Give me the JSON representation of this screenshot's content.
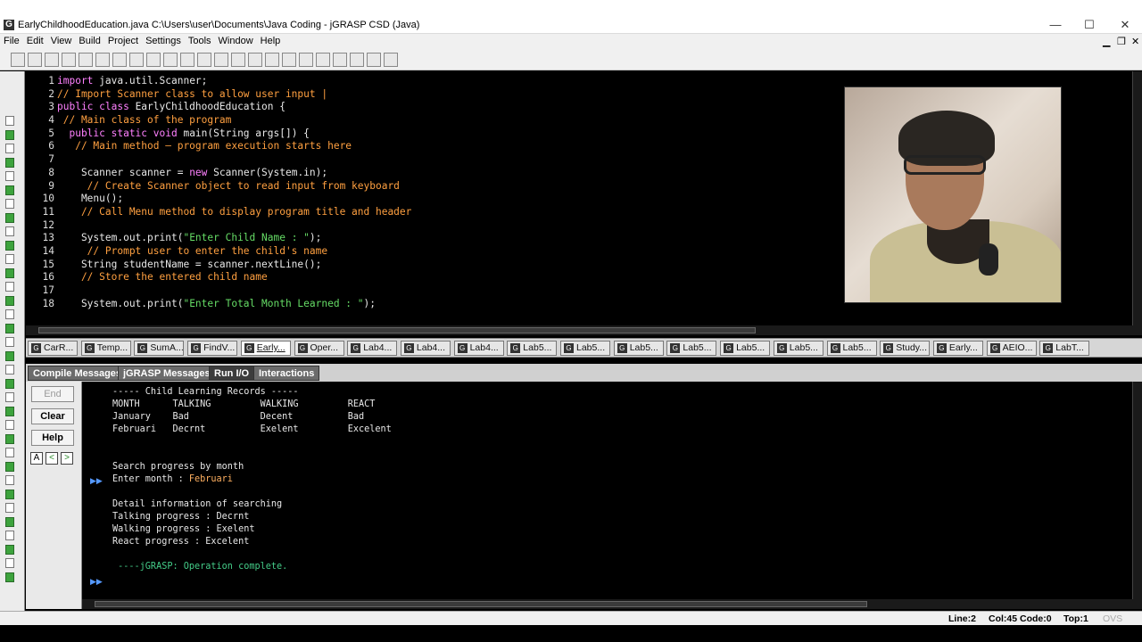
{
  "window": {
    "title": "EarlyChildhoodEducation.java  C:\\Users\\user\\Documents\\Java Coding - jGRASP CSD (Java)",
    "app_icon": "G",
    "controls": {
      "minimize": "—",
      "maximize": "☐",
      "close": "✕"
    }
  },
  "menu": {
    "items": [
      "File",
      "Edit",
      "View",
      "Build",
      "Project",
      "Settings",
      "Tools",
      "Window",
      "Help"
    ],
    "right_controls": [
      "▁",
      "❐",
      "✕"
    ]
  },
  "toolbar": {
    "icons": [
      "open-folder-icon",
      "save-icon",
      "save-all-icon",
      "print-icon",
      "cut-icon",
      "copy-icon",
      "paste-icon",
      "undo-icon",
      "redo-icon",
      "font-icon",
      "new-file-icon",
      "new-doc-icon",
      "new-doc2-icon",
      "breakpoint-icon",
      "chart-icon",
      "run-icon",
      "book-icon",
      "add-icon",
      "debug-icon",
      "bug-icon",
      "stop-icon",
      "window-icon",
      "green-icon"
    ]
  },
  "editor": {
    "lines": [
      {
        "n": "1",
        "segs": [
          {
            "t": "import",
            "c": "kw"
          },
          {
            "t": " java.util.Scanner;",
            "c": ""
          }
        ]
      },
      {
        "n": "2",
        "segs": [
          {
            "t": "// Import Scanner class to allow user input |",
            "c": "cm"
          }
        ]
      },
      {
        "n": "3",
        "segs": [
          {
            "t": "public class",
            "c": "kw"
          },
          {
            "t": " EarlyChildhoodEducation {",
            "c": ""
          }
        ]
      },
      {
        "n": "4",
        "segs": [
          {
            "t": " // Main class of the program",
            "c": "cm"
          }
        ]
      },
      {
        "n": "5",
        "segs": [
          {
            "t": "  public static void",
            "c": "kw"
          },
          {
            "t": " main(String args[]) {",
            "c": ""
          }
        ]
      },
      {
        "n": "6",
        "segs": [
          {
            "t": "   // Main method – program execution starts here",
            "c": "cm"
          }
        ]
      },
      {
        "n": "7",
        "segs": [
          {
            "t": "",
            "c": ""
          }
        ]
      },
      {
        "n": "8",
        "segs": [
          {
            "t": "    Scanner scanner = ",
            "c": ""
          },
          {
            "t": "new",
            "c": "kw"
          },
          {
            "t": " Scanner(System.in);",
            "c": ""
          }
        ]
      },
      {
        "n": "9",
        "segs": [
          {
            "t": "     // Create Scanner object to read input from keyboard",
            "c": "cm"
          }
        ]
      },
      {
        "n": "10",
        "segs": [
          {
            "t": "    Menu();",
            "c": ""
          }
        ]
      },
      {
        "n": "11",
        "segs": [
          {
            "t": "    // Call Menu method to display program title and header",
            "c": "cm"
          }
        ]
      },
      {
        "n": "12",
        "segs": [
          {
            "t": "",
            "c": ""
          }
        ]
      },
      {
        "n": "13",
        "segs": [
          {
            "t": "    System.out.print(",
            "c": ""
          },
          {
            "t": "\"Enter Child Name : \"",
            "c": "st"
          },
          {
            "t": ");",
            "c": ""
          }
        ]
      },
      {
        "n": "14",
        "segs": [
          {
            "t": "     // Prompt user to enter the child's name",
            "c": "cm"
          }
        ]
      },
      {
        "n": "15",
        "segs": [
          {
            "t": "    String studentName = scanner.nextLine();",
            "c": ""
          }
        ]
      },
      {
        "n": "16",
        "segs": [
          {
            "t": "    // Store the entered child name",
            "c": "cm"
          }
        ]
      },
      {
        "n": "17",
        "segs": [
          {
            "t": "",
            "c": ""
          }
        ]
      },
      {
        "n": "18",
        "segs": [
          {
            "t": "    System.out.print(",
            "c": ""
          },
          {
            "t": "\"Enter Total Month Learned : \"",
            "c": "st"
          },
          {
            "t": ");",
            "c": ""
          }
        ]
      }
    ]
  },
  "file_tabs": [
    "CarR...",
    "Temp...",
    "SumA...",
    "FindV...",
    "Early...",
    "Oper...",
    "Lab4...",
    "Lab4...",
    "Lab4...",
    "Lab5...",
    "Lab5...",
    "Lab5...",
    "Lab5...",
    "Lab5...",
    "Lab5...",
    "Lab5...",
    "Study...",
    "Early...",
    "AEIO...",
    "LabT..."
  ],
  "active_file_tab": 4,
  "message_tabs": [
    "Compile Messages",
    "jGRASP Messages",
    "Run I/O",
    "Interactions"
  ],
  "active_message_tab": 2,
  "io_buttons": {
    "end": "End",
    "clear": "Clear",
    "help": "Help",
    "small": [
      "A",
      "<",
      ">"
    ]
  },
  "output": {
    "lines": [
      {
        "t": "----- Child Learning Records -----",
        "c": ""
      },
      {
        "t": "MONTH      TALKING         WALKING         REACT",
        "c": ""
      },
      {
        "t": "January    Bad             Decent          Bad",
        "c": ""
      },
      {
        "t": "Februari   Decrnt          Exelent         Excelent",
        "c": ""
      },
      {
        "t": "",
        "c": ""
      },
      {
        "t": "",
        "c": ""
      },
      {
        "t": "Search progress by month",
        "c": ""
      },
      {
        "t": "Enter month : ",
        "c": "",
        "input": "Februari"
      },
      {
        "t": "",
        "c": ""
      },
      {
        "t": "Detail information of searching",
        "c": ""
      },
      {
        "t": "Talking progress : Decrnt",
        "c": ""
      },
      {
        "t": "Walking progress : Exelent",
        "c": ""
      },
      {
        "t": "React progress : Excelent",
        "c": ""
      },
      {
        "t": "",
        "c": ""
      },
      {
        "t": " ----jGRASP: Operation complete.",
        "c": "done"
      }
    ],
    "arrow": "▶▶"
  },
  "status": {
    "line": "Line:2",
    "col": "Col:45",
    "code": "Code:0",
    "top": "Top:1",
    "mode": "OVS BLK"
  },
  "colors": {
    "keyword": "#ff80ff",
    "comment": "#ffa040",
    "string": "#66dd66",
    "input": "#ffb060",
    "done": "#44cc88"
  }
}
